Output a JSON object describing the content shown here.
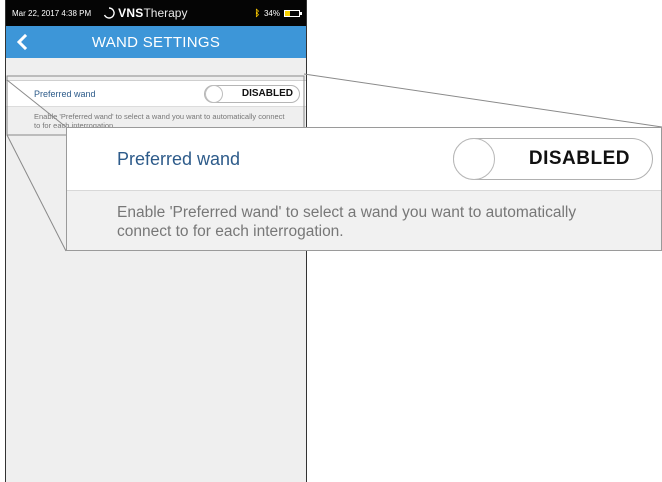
{
  "status_bar": {
    "datetime": "Mar 22, 2017  4:38 PM",
    "brand_bold": "VNS",
    "brand_light": "Therapy",
    "battery": "34%",
    "battery_level": 0.34,
    "battery_color": "#f5d000"
  },
  "nav": {
    "title": "WAND SETTINGS",
    "back_icon": "chevron-left-icon",
    "color": "#3d96d8"
  },
  "setting": {
    "label": "Preferred wand",
    "toggle_state": "DISABLED",
    "description": "Enable 'Preferred wand' to select a wand you want to automatically connect to for each interrogation."
  },
  "zoom": {
    "label": "Preferred wand",
    "toggle_state": "DISABLED",
    "description": "Enable 'Preferred wand' to select a wand you want to automatically connect to for each interrogation."
  }
}
